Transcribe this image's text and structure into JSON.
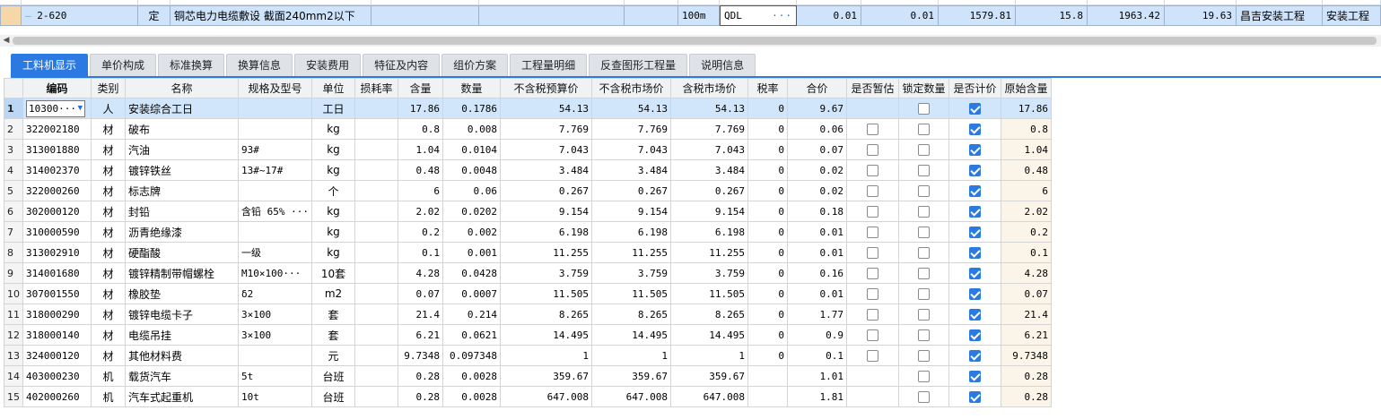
{
  "top_row": {
    "code": "2-620",
    "type": "定",
    "name": "铜芯电力电缆敷设 截面240mm2以下",
    "unit": "100m",
    "qty_expr": "QDL",
    "qty_expr_more": "···",
    "v1": "0.01",
    "v2": "0.01",
    "v3": "1579.81",
    "v4": "15.8",
    "v5": "1963.42",
    "v6": "19.63",
    "project": "昌吉安装工程",
    "specialty": "安装工程"
  },
  "tabs": [
    {
      "label": "工料机显示",
      "active": true
    },
    {
      "label": "单价构成",
      "active": false
    },
    {
      "label": "标准换算",
      "active": false
    },
    {
      "label": "换算信息",
      "active": false
    },
    {
      "label": "安装费用",
      "active": false
    },
    {
      "label": "特征及内容",
      "active": false
    },
    {
      "label": "组价方案",
      "active": false
    },
    {
      "label": "工程量明细",
      "active": false
    },
    {
      "label": "反查图形工程量",
      "active": false
    },
    {
      "label": "说明信息",
      "active": false
    }
  ],
  "columns": [
    "编码",
    "类别",
    "名称",
    "规格及型号",
    "单位",
    "损耗率",
    "含量",
    "数量",
    "不含税预算价",
    "不含税市场价",
    "含税市场价",
    "税率",
    "合价",
    "是否暂估",
    "锁定数量",
    "是否计价",
    "原始含量"
  ],
  "rows": [
    {
      "idx": "1",
      "code": "10300···",
      "cat": "人",
      "name": "安装综合工日",
      "spec": "",
      "unit": "工日",
      "loss": "",
      "content": "17.86",
      "qty": "0.1786",
      "p1": "54.13",
      "p2": "54.13",
      "p3": "54.13",
      "tax": "0",
      "total": "9.67",
      "est": null,
      "lock": false,
      "priced": true,
      "orig": "17.86"
    },
    {
      "idx": "2",
      "code": "322002180",
      "cat": "材",
      "name": "破布",
      "spec": "",
      "unit": "kg",
      "loss": "",
      "content": "0.8",
      "qty": "0.008",
      "p1": "7.769",
      "p2": "7.769",
      "p3": "7.769",
      "tax": "0",
      "total": "0.06",
      "est": false,
      "lock": false,
      "priced": true,
      "orig": "0.8"
    },
    {
      "idx": "3",
      "code": "313001880",
      "cat": "材",
      "name": "汽油",
      "spec": "93#",
      "unit": "kg",
      "loss": "",
      "content": "1.04",
      "qty": "0.0104",
      "p1": "7.043",
      "p2": "7.043",
      "p3": "7.043",
      "tax": "0",
      "total": "0.07",
      "est": false,
      "lock": false,
      "priced": true,
      "orig": "1.04"
    },
    {
      "idx": "4",
      "code": "314002370",
      "cat": "材",
      "name": "镀锌铁丝",
      "spec": "13#~17#",
      "unit": "kg",
      "loss": "",
      "content": "0.48",
      "qty": "0.0048",
      "p1": "3.484",
      "p2": "3.484",
      "p3": "3.484",
      "tax": "0",
      "total": "0.02",
      "est": false,
      "lock": false,
      "priced": true,
      "orig": "0.48"
    },
    {
      "idx": "5",
      "code": "322000260",
      "cat": "材",
      "name": "标志牌",
      "spec": "",
      "unit": "个",
      "loss": "",
      "content": "6",
      "qty": "0.06",
      "p1": "0.267",
      "p2": "0.267",
      "p3": "0.267",
      "tax": "0",
      "total": "0.02",
      "est": false,
      "lock": false,
      "priced": true,
      "orig": "6"
    },
    {
      "idx": "6",
      "code": "302000120",
      "cat": "材",
      "name": "封铅",
      "spec": "含铅 65% ···",
      "unit": "kg",
      "loss": "",
      "content": "2.02",
      "qty": "0.0202",
      "p1": "9.154",
      "p2": "9.154",
      "p3": "9.154",
      "tax": "0",
      "total": "0.18",
      "est": false,
      "lock": false,
      "priced": true,
      "orig": "2.02"
    },
    {
      "idx": "7",
      "code": "310000590",
      "cat": "材",
      "name": "沥青绝缘漆",
      "spec": "",
      "unit": "kg",
      "loss": "",
      "content": "0.2",
      "qty": "0.002",
      "p1": "6.198",
      "p2": "6.198",
      "p3": "6.198",
      "tax": "0",
      "total": "0.01",
      "est": false,
      "lock": false,
      "priced": true,
      "orig": "0.2"
    },
    {
      "idx": "8",
      "code": "313002910",
      "cat": "材",
      "name": "硬酯酸",
      "spec": "一级",
      "unit": "kg",
      "loss": "",
      "content": "0.1",
      "qty": "0.001",
      "p1": "11.255",
      "p2": "11.255",
      "p3": "11.255",
      "tax": "0",
      "total": "0.01",
      "est": false,
      "lock": false,
      "priced": true,
      "orig": "0.1"
    },
    {
      "idx": "9",
      "code": "314001680",
      "cat": "材",
      "name": "镀锌精制带帽螺栓",
      "spec": "M10×100···",
      "unit": "10套",
      "loss": "",
      "content": "4.28",
      "qty": "0.0428",
      "p1": "3.759",
      "p2": "3.759",
      "p3": "3.759",
      "tax": "0",
      "total": "0.16",
      "est": false,
      "lock": false,
      "priced": true,
      "orig": "4.28"
    },
    {
      "idx": "10",
      "code": "307001550",
      "cat": "材",
      "name": "橡胶垫",
      "spec": "δ2",
      "unit": "m2",
      "loss": "",
      "content": "0.07",
      "qty": "0.0007",
      "p1": "11.505",
      "p2": "11.505",
      "p3": "11.505",
      "tax": "0",
      "total": "0.01",
      "est": false,
      "lock": false,
      "priced": true,
      "orig": "0.07"
    },
    {
      "idx": "11",
      "code": "318000290",
      "cat": "材",
      "name": "镀锌电缆卡子",
      "spec": "3×100",
      "unit": "套",
      "loss": "",
      "content": "21.4",
      "qty": "0.214",
      "p1": "8.265",
      "p2": "8.265",
      "p3": "8.265",
      "tax": "0",
      "total": "1.77",
      "est": false,
      "lock": false,
      "priced": true,
      "orig": "21.4"
    },
    {
      "idx": "12",
      "code": "318000140",
      "cat": "材",
      "name": "电缆吊挂",
      "spec": "3×100",
      "unit": "套",
      "loss": "",
      "content": "6.21",
      "qty": "0.0621",
      "p1": "14.495",
      "p2": "14.495",
      "p3": "14.495",
      "tax": "0",
      "total": "0.9",
      "est": false,
      "lock": false,
      "priced": true,
      "orig": "6.21"
    },
    {
      "idx": "13",
      "code": "324000120",
      "cat": "材",
      "name": "其他材料费",
      "spec": "",
      "unit": "元",
      "loss": "",
      "content": "9.7348",
      "qty": "0.097348",
      "p1": "1",
      "p2": "1",
      "p3": "1",
      "tax": "0",
      "total": "0.1",
      "est": false,
      "lock": false,
      "priced": true,
      "orig": "9.7348"
    },
    {
      "idx": "14",
      "code": "403000230",
      "cat": "机",
      "name": "载货汽车",
      "spec": "5t",
      "unit": "台班",
      "loss": "",
      "content": "0.28",
      "qty": "0.0028",
      "p1": "359.67",
      "p2": "359.67",
      "p3": "359.67",
      "tax": "",
      "total": "1.01",
      "est": null,
      "lock": false,
      "priced": true,
      "orig": "0.28"
    },
    {
      "idx": "15",
      "code": "402000260",
      "cat": "机",
      "name": "汽车式起重机",
      "spec": "10t",
      "unit": "台班",
      "loss": "",
      "content": "0.28",
      "qty": "0.0028",
      "p1": "647.008",
      "p2": "647.008",
      "p3": "647.008",
      "tax": "",
      "total": "1.81",
      "est": null,
      "lock": false,
      "priced": true,
      "orig": "0.28"
    }
  ],
  "colors": {
    "accent": "#2a7ae2",
    "selected_row": "#d2e6fb",
    "top_row": "#cfe4fb",
    "row_marker": "#f5d7a8"
  }
}
